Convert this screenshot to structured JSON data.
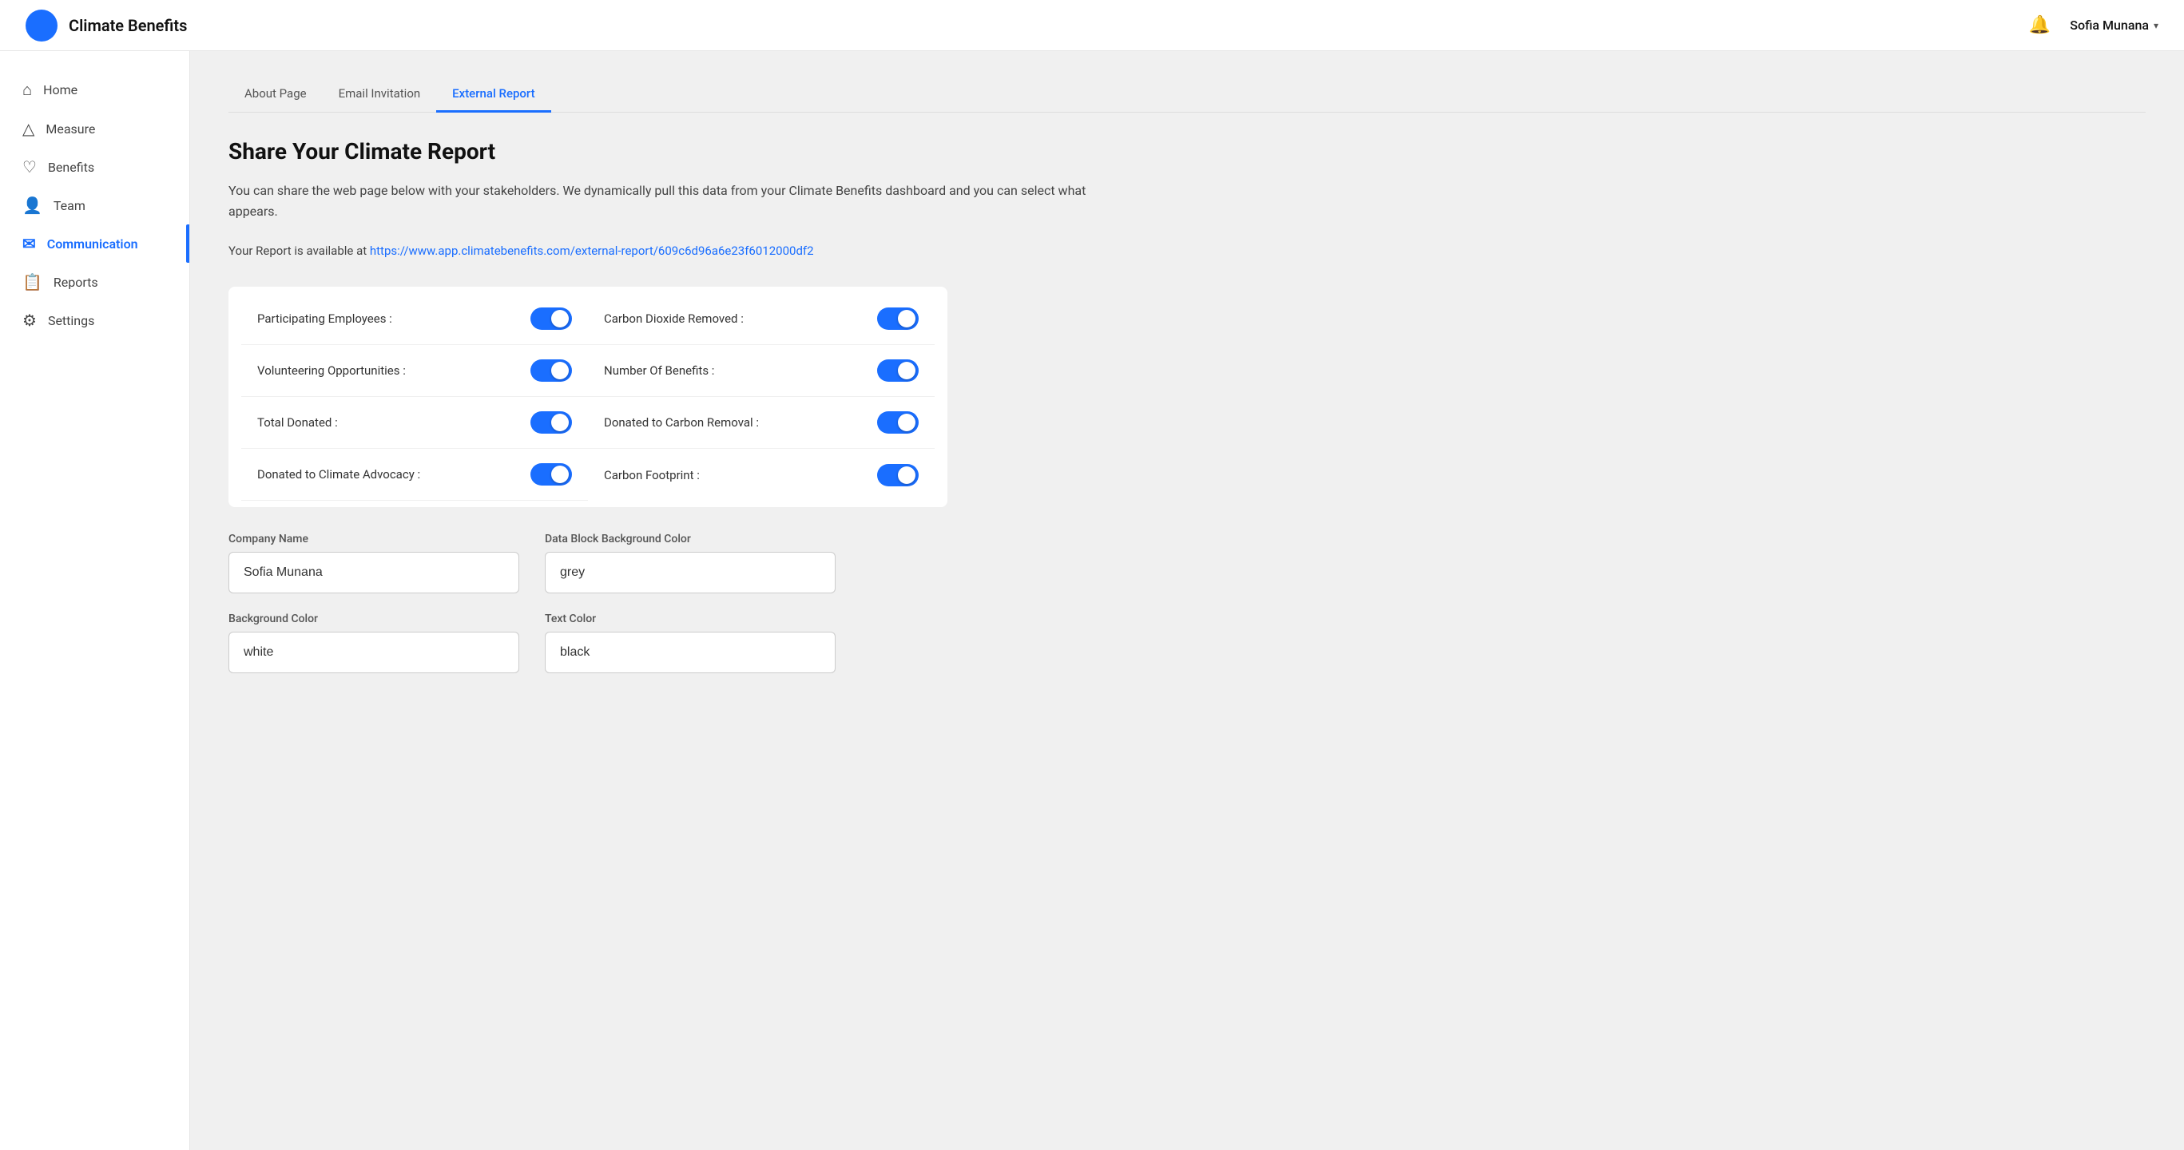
{
  "app": {
    "title": "Climate Benefits",
    "logo_alt": "Climate Benefits Logo"
  },
  "topnav": {
    "bell_label": "Notifications",
    "user_name": "Sofia Munana",
    "chevron": "▾"
  },
  "sidebar": {
    "items": [
      {
        "id": "home",
        "label": "Home",
        "icon": "⌂"
      },
      {
        "id": "measure",
        "label": "Measure",
        "icon": "△"
      },
      {
        "id": "benefits",
        "label": "Benefits",
        "icon": "♡"
      },
      {
        "id": "team",
        "label": "Team",
        "icon": "👤"
      },
      {
        "id": "communication",
        "label": "Communication",
        "icon": "✉"
      },
      {
        "id": "reports",
        "label": "Reports",
        "icon": "📋"
      },
      {
        "id": "settings",
        "label": "Settings",
        "icon": "⚙"
      }
    ]
  },
  "tabs": [
    {
      "id": "about",
      "label": "About Page",
      "active": false
    },
    {
      "id": "email",
      "label": "Email Invitation",
      "active": false
    },
    {
      "id": "external",
      "label": "External Report",
      "active": true
    }
  ],
  "page": {
    "title": "Share Your Climate Report",
    "description": "You can share the web page below with your stakeholders. We dynamically pull this data from your Climate Benefits dashboard and you can select what appears.",
    "report_label": "Your Report is available at",
    "report_url": "https://www.app.climatebenefits.com/external-report/609c6d96a6e23f6012000df2"
  },
  "toggles": [
    {
      "label": "Participating Employees :",
      "enabled": true
    },
    {
      "label": "Carbon Dioxide Removed :",
      "enabled": true
    },
    {
      "label": "Volunteering Opportunities :",
      "enabled": true
    },
    {
      "label": "Number Of Benefits :",
      "enabled": true
    },
    {
      "label": "Total Donated :",
      "enabled": true
    },
    {
      "label": "Donated to Carbon Removal :",
      "enabled": true
    },
    {
      "label": "Donated to Climate Advocacy :",
      "enabled": true
    },
    {
      "label": "Carbon Footprint :",
      "enabled": true
    }
  ],
  "form": {
    "fields": [
      {
        "id": "company-name",
        "label": "Company Name",
        "value": "Sofia Munana",
        "placeholder": "Company Name"
      },
      {
        "id": "data-block-bg",
        "label": "Data Block Background Color",
        "value": "grey",
        "placeholder": "grey"
      },
      {
        "id": "background-color",
        "label": "Background Color",
        "value": "white",
        "placeholder": "white"
      },
      {
        "id": "text-color",
        "label": "Text Color",
        "value": "black",
        "placeholder": "black"
      }
    ]
  },
  "colors": {
    "accent": "#1a6eff",
    "active_sidebar": "#1a6eff"
  }
}
